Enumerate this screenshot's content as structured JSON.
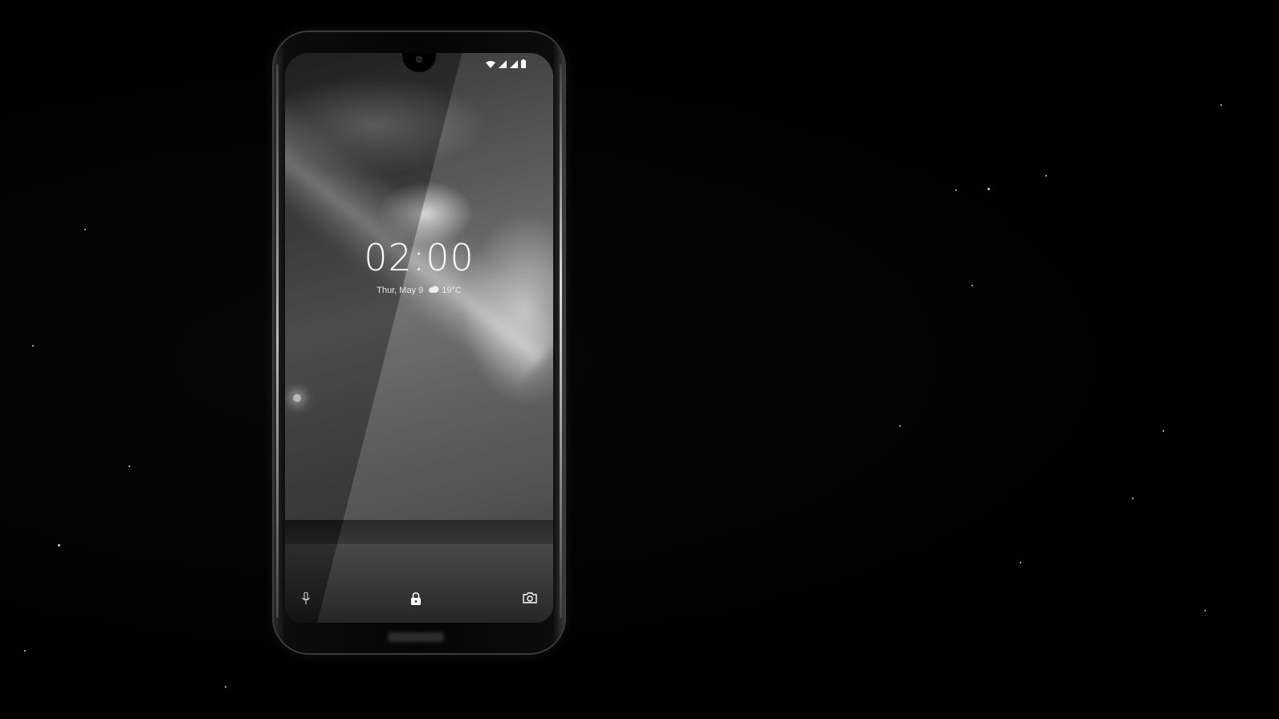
{
  "lockscreen": {
    "time": "02:00",
    "date": "Thur, May 9",
    "temperature": "19°C",
    "weather_icon": "cloud-icon"
  },
  "statusbar": {
    "icons": [
      "wifi-icon",
      "signal-icon",
      "signal-icon",
      "battery-icon"
    ]
  },
  "bottom_shortcuts": {
    "left": "microphone-icon",
    "center": "lock-icon",
    "right": "camera-icon"
  },
  "colors": {
    "background": "#000000",
    "text": "#fafafa"
  }
}
